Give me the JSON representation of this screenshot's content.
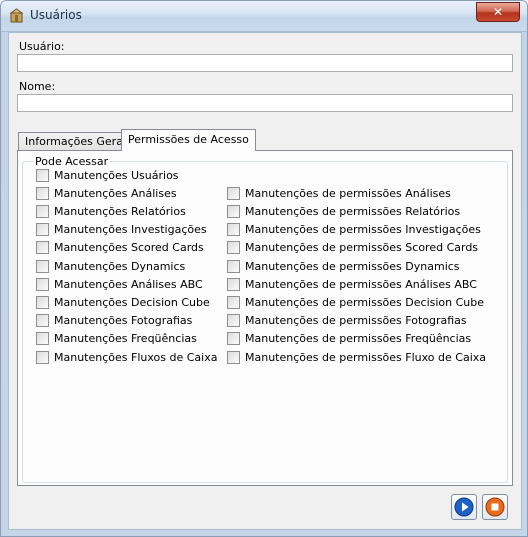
{
  "window": {
    "title": "Usuários",
    "close_label": "✕",
    "icon": "user-package-icon"
  },
  "form": {
    "usuario_label": "Usuário:",
    "usuario_value": "",
    "nome_label": "Nome:",
    "nome_value": ""
  },
  "tabs": [
    {
      "label": "Informações Gerais",
      "active": false
    },
    {
      "label": "Permissões de Acesso",
      "active": true
    }
  ],
  "permissions": {
    "group_title": "Pode Acessar",
    "left": [
      {
        "label": "Manutenções Usuários",
        "checked": false
      },
      {
        "label": "Manutenções Análises",
        "checked": false
      },
      {
        "label": "Manutenções Relatórios",
        "checked": false
      },
      {
        "label": "Manutenções Investigações",
        "checked": false
      },
      {
        "label": "Manutenções Scored Cards",
        "checked": false
      },
      {
        "label": "Manutenções Dynamics",
        "checked": false
      },
      {
        "label": "Manutenções Análises ABC",
        "checked": false
      },
      {
        "label": "Manutenções Decision Cube",
        "checked": false
      },
      {
        "label": "Manutenções Fotografias",
        "checked": false
      },
      {
        "label": "Manutenções Freqüências",
        "checked": false
      },
      {
        "label": "Manutenções Fluxos de Caixa",
        "checked": false
      }
    ],
    "right": [
      {
        "label": "Manutenções de permissões Análises",
        "checked": false
      },
      {
        "label": "Manutenções de permissões Relatórios",
        "checked": false
      },
      {
        "label": "Manutenções de permissões Investigações",
        "checked": false
      },
      {
        "label": "Manutenções de permissões Scored Cards",
        "checked": false
      },
      {
        "label": "Manutenções de permissões Dynamics",
        "checked": false
      },
      {
        "label": "Manutenções de permissões Análises ABC",
        "checked": false
      },
      {
        "label": "Manutenções de permissões Decision Cube",
        "checked": false
      },
      {
        "label": "Manutenções de permissões Fotografias",
        "checked": false
      },
      {
        "label": "Manutenções de permissões Freqüências",
        "checked": false
      },
      {
        "label": "Manutenções de permissões Fluxo de Caixa",
        "checked": false
      }
    ]
  },
  "buttons": {
    "ok_icon": "play-icon",
    "cancel_icon": "stop-icon"
  }
}
